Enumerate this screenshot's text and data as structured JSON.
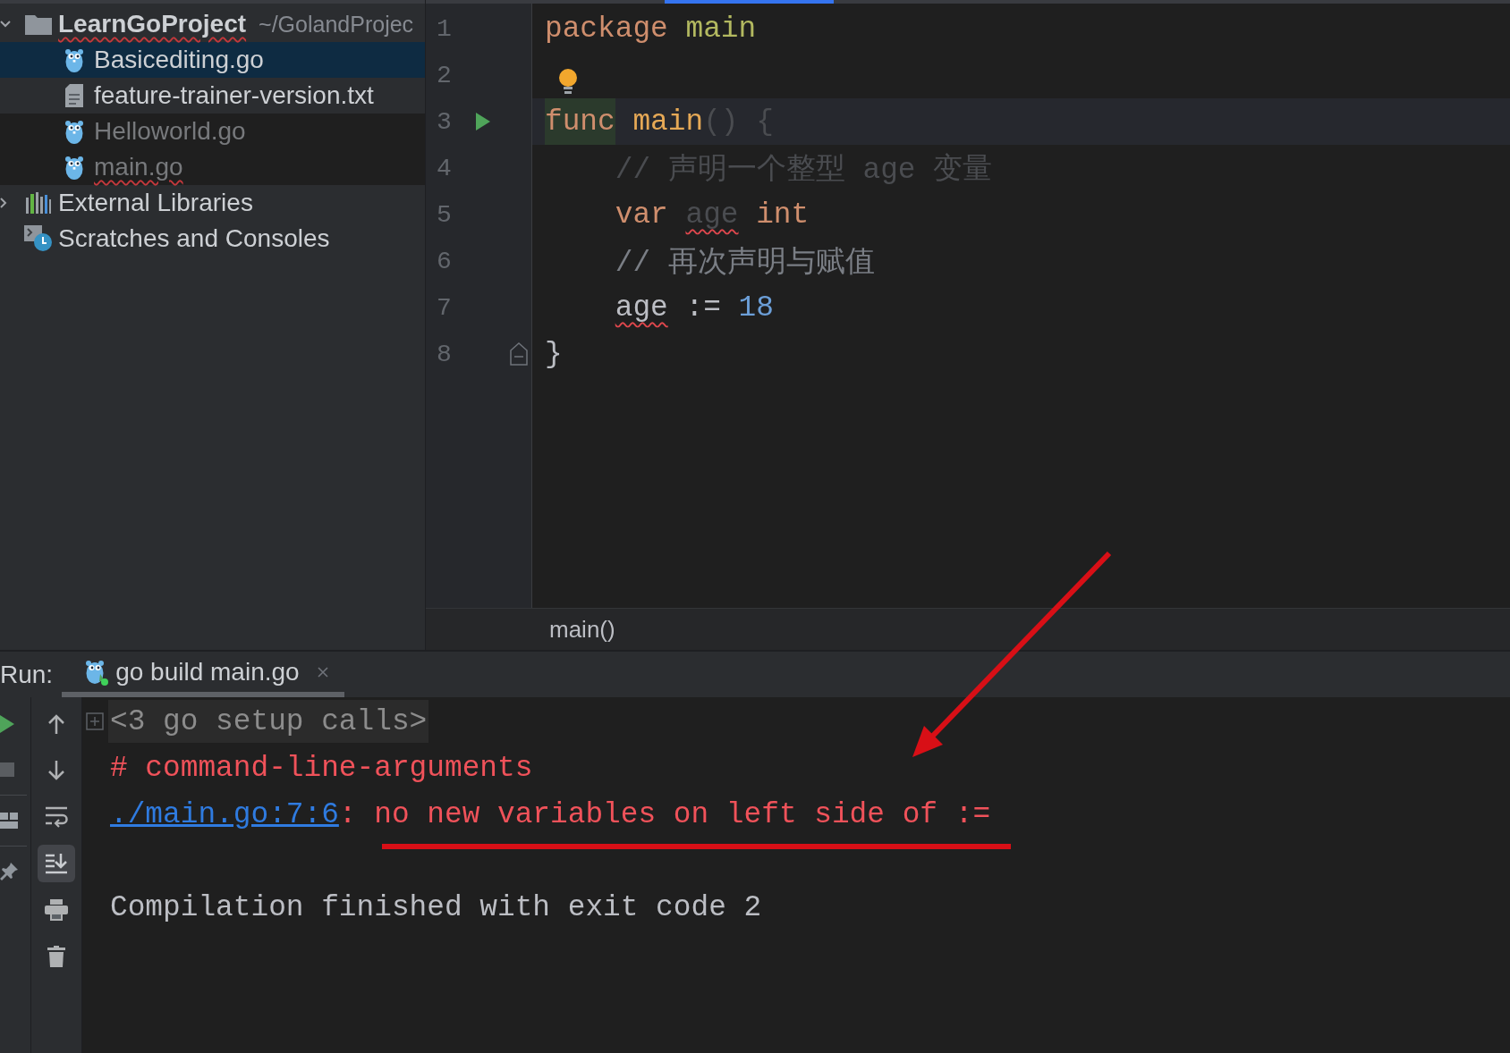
{
  "project_tree": {
    "nodes": [
      {
        "label": "LearnGoProject",
        "kind": "project",
        "path": "~/GolandProjec",
        "expanded": true,
        "selected": false,
        "error": true,
        "obscured": false,
        "children": [
          {
            "label": "Basicediting.go",
            "kind": "go",
            "selected": true,
            "error": false,
            "obscured": false
          },
          {
            "label": "feature-trainer-version.txt",
            "kind": "text",
            "selected": false,
            "error": false,
            "obscured": false
          },
          {
            "label": "Helloworld.go",
            "kind": "go",
            "selected": false,
            "error": false,
            "obscured": true
          },
          {
            "label": "main.go",
            "kind": "go",
            "selected": false,
            "error": true,
            "obscured": true
          }
        ]
      },
      {
        "label": "External Libraries",
        "kind": "libraries",
        "expanded": false,
        "selected": false,
        "error": false,
        "obscured": false
      },
      {
        "label": "Scratches and Consoles",
        "kind": "scratches",
        "selected": false,
        "error": false,
        "obscured": false
      }
    ]
  },
  "editor": {
    "lines": [
      {
        "number": "1",
        "current": false,
        "indented": false,
        "run": false,
        "fold": false,
        "bulb": false,
        "tokens": [
          {
            "text": "package ",
            "kind": "keyword",
            "error": false,
            "obscured": false,
            "highlight": false
          },
          {
            "text": "main",
            "kind": "package",
            "error": false,
            "obscured": false,
            "highlight": false
          }
        ]
      },
      {
        "number": "2",
        "current": false,
        "indented": false,
        "run": false,
        "fold": false,
        "bulb": true
      },
      {
        "number": "3",
        "current": true,
        "indented": false,
        "run": true,
        "fold": false,
        "bulb": false,
        "tokens": [
          {
            "text": "func",
            "kind": "keyword",
            "error": false,
            "obscured": false,
            "highlight": true
          },
          {
            "text": " main",
            "kind": "function",
            "error": false,
            "obscured": false,
            "highlight": false
          },
          {
            "text": "() {",
            "kind": "punct",
            "error": false,
            "obscured": true,
            "highlight": false
          }
        ]
      },
      {
        "number": "4",
        "current": false,
        "indented": true,
        "run": false,
        "fold": false,
        "bulb": false,
        "tokens": [
          {
            "text": "// 声明一个整型 age 变量",
            "kind": "comment",
            "error": false,
            "obscured": true,
            "highlight": false
          }
        ]
      },
      {
        "number": "5",
        "current": false,
        "indented": true,
        "run": false,
        "fold": false,
        "bulb": false,
        "tokens": [
          {
            "text": "var ",
            "kind": "keyword",
            "error": false,
            "obscured": false,
            "highlight": false
          },
          {
            "text": "age",
            "kind": "ident",
            "error": true,
            "obscured": true,
            "highlight": false
          },
          {
            "text": " int",
            "kind": "keyword",
            "error": false,
            "obscured": false,
            "highlight": false
          }
        ]
      },
      {
        "number": "6",
        "current": false,
        "indented": true,
        "run": false,
        "fold": false,
        "bulb": false,
        "tokens": [
          {
            "text": "// 再次声明与赋值",
            "kind": "comment",
            "error": false,
            "obscured": false,
            "highlight": false
          }
        ]
      },
      {
        "number": "7",
        "current": false,
        "indented": true,
        "run": false,
        "fold": false,
        "bulb": false,
        "tokens": [
          {
            "text": "age",
            "kind": "ident",
            "error": true,
            "obscured": false,
            "highlight": false
          },
          {
            "text": " := ",
            "kind": "operator",
            "error": false,
            "obscured": false,
            "highlight": false
          },
          {
            "text": "18",
            "kind": "number",
            "error": false,
            "obscured": false,
            "highlight": false
          }
        ]
      },
      {
        "number": "8",
        "current": false,
        "indented": false,
        "run": false,
        "fold": true,
        "bulb": false,
        "tokens": [
          {
            "text": "}",
            "kind": "punct",
            "error": false,
            "obscured": false,
            "highlight": false
          }
        ]
      }
    ],
    "breadcrumb": [
      "main()"
    ]
  },
  "run_panel": {
    "title": "Run:",
    "tabs": [
      {
        "label": "go build main.go",
        "selected": true,
        "closable": true
      }
    ],
    "side_actions": [
      [
        {
          "kind": "rerun"
        },
        {
          "kind": "stop"
        }
      ],
      [
        {
          "kind": "layout"
        }
      ],
      [
        {
          "kind": "pin"
        }
      ]
    ],
    "actions": [
      {
        "kind": "up",
        "on": false
      },
      {
        "kind": "down",
        "on": false
      },
      {
        "kind": "soft-wrap",
        "on": false
      },
      {
        "kind": "scroll-to-end",
        "on": true
      },
      {
        "kind": "print",
        "on": false
      },
      {
        "kind": "clear",
        "on": false
      }
    ],
    "console": [
      {
        "kind": "fold",
        "text": "<3 go setup calls>",
        "expanded": false
      },
      {
        "kind": "error",
        "text": "# command-line-arguments"
      },
      {
        "kind": "error",
        "link": "./main.go:7:6",
        "text": ": no new variables on left side of :="
      },
      {
        "kind": "blank"
      },
      {
        "kind": "info",
        "text": "Compilation finished with exit code 2"
      }
    ]
  }
}
